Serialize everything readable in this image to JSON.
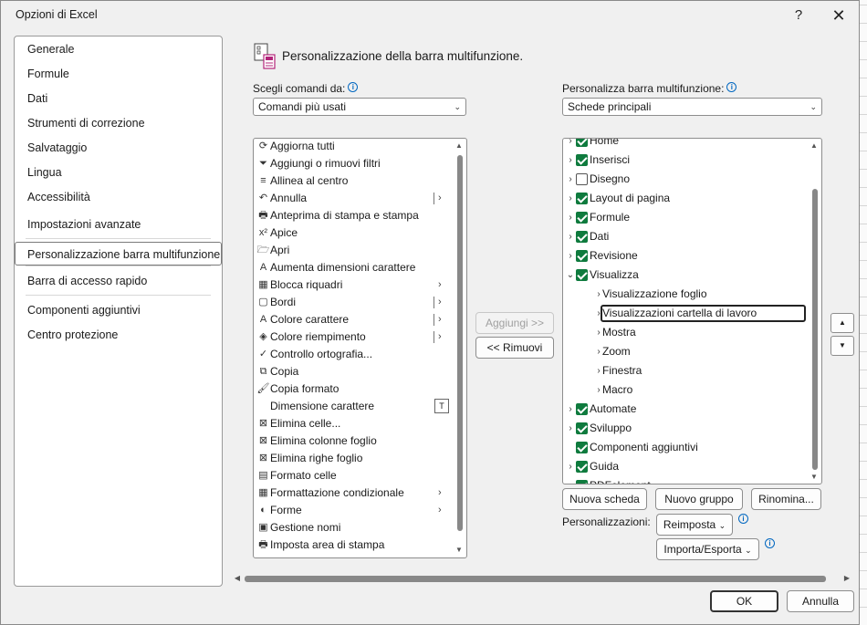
{
  "dialog": {
    "title": "Opzioni di Excel",
    "help_glyph": "?",
    "close_glyph": "✕"
  },
  "nav": {
    "items": [
      {
        "label": "Generale"
      },
      {
        "label": "Formule"
      },
      {
        "label": "Dati"
      },
      {
        "label": "Strumenti di correzione"
      },
      {
        "label": "Salvataggio"
      },
      {
        "label": "Lingua"
      },
      {
        "label": "Accessibilità"
      },
      {
        "label": "Impostazioni avanzate"
      },
      {
        "label": "Personalizzazione barra multifunzione",
        "selected": true
      },
      {
        "label": "Barra di accesso rapido"
      },
      {
        "label": "Componenti aggiuntivi"
      },
      {
        "label": "Centro protezione"
      }
    ]
  },
  "heading": {
    "text": "Personalizzazione della barra multifunzione.",
    "icon": "customize-ribbon-icon"
  },
  "left_panel": {
    "label": "Scegli comandi da:",
    "combo_value": "Comandi più usati",
    "commands": [
      {
        "label": "Aggiorna tutti",
        "icon": "refresh-icon",
        "glyph": "⟳"
      },
      {
        "label": "Aggiungi o rimuovi filtri",
        "icon": "filter-icon",
        "glyph": "⏷"
      },
      {
        "label": "Allinea al centro",
        "icon": "align-center-icon",
        "glyph": "≡"
      },
      {
        "label": "Annulla",
        "icon": "undo-icon",
        "glyph": "↶",
        "split": true
      },
      {
        "label": "Anteprima di stampa e stampa",
        "icon": "print-preview-icon",
        "glyph": "🖶"
      },
      {
        "label": "Apice",
        "icon": "superscript-icon",
        "glyph": "x²"
      },
      {
        "label": "Apri",
        "icon": "open-folder-icon",
        "glyph": "🗁"
      },
      {
        "label": "Aumenta dimensioni carattere",
        "icon": "grow-font-icon",
        "glyph": "A"
      },
      {
        "label": "Blocca riquadri",
        "icon": "freeze-panes-icon",
        "glyph": "▦",
        "submenu": true
      },
      {
        "label": "Bordi",
        "icon": "borders-icon",
        "glyph": "▢",
        "split": true
      },
      {
        "label": "Colore carattere",
        "icon": "font-color-icon",
        "glyph": "A",
        "split": true
      },
      {
        "label": "Colore riempimento",
        "icon": "fill-color-icon",
        "glyph": "◈",
        "split": true
      },
      {
        "label": "Controllo ortografia...",
        "icon": "spelling-icon",
        "glyph": "✓"
      },
      {
        "label": "Copia",
        "icon": "copy-icon",
        "glyph": "⧉"
      },
      {
        "label": "Copia formato",
        "icon": "format-painter-icon",
        "glyph": "🖌"
      },
      {
        "label": "Dimensione carattere",
        "icon": "font-size-icon",
        "glyph": "",
        "sizebox": true
      },
      {
        "label": "Elimina celle...",
        "icon": "delete-cells-icon",
        "glyph": "⊠"
      },
      {
        "label": "Elimina colonne foglio",
        "icon": "delete-columns-icon",
        "glyph": "⊠"
      },
      {
        "label": "Elimina righe foglio",
        "icon": "delete-rows-icon",
        "glyph": "⊠"
      },
      {
        "label": "Formato celle",
        "icon": "format-cells-icon",
        "glyph": "▤"
      },
      {
        "label": "Formattazione condizionale",
        "icon": "conditional-format-icon",
        "glyph": "▦",
        "submenu": true
      },
      {
        "label": "Forme",
        "icon": "shapes-icon",
        "glyph": "◐",
        "submenu": true
      },
      {
        "label": "Gestione nomi",
        "icon": "name-manager-icon",
        "glyph": "▣"
      },
      {
        "label": "Imposta area di stampa",
        "icon": "print-area-icon",
        "glyph": "🖶"
      }
    ]
  },
  "middle": {
    "add_label": "Aggiungi >>",
    "remove_label": "<< Rimuovi"
  },
  "right_panel": {
    "label": "Personalizza barra multifunzione:",
    "combo_value": "Schede principali",
    "tree": [
      {
        "label": "Home",
        "checked": true,
        "level": 0,
        "expander": "›"
      },
      {
        "label": "Inserisci",
        "checked": true,
        "level": 0,
        "expander": "›"
      },
      {
        "label": "Disegno",
        "checked": false,
        "level": 0,
        "expander": "›"
      },
      {
        "label": "Layout di pagina",
        "checked": true,
        "level": 0,
        "expander": "›"
      },
      {
        "label": "Formule",
        "checked": true,
        "level": 0,
        "expander": "›"
      },
      {
        "label": "Dati",
        "checked": true,
        "level": 0,
        "expander": "›"
      },
      {
        "label": "Revisione",
        "checked": true,
        "level": 0,
        "expander": "›"
      },
      {
        "label": "Visualizza",
        "checked": true,
        "level": 0,
        "expander": "⌄"
      },
      {
        "label": "Visualizzazione foglio",
        "level": 1,
        "expander": "›"
      },
      {
        "label": "Visualizzazioni cartella di lavoro",
        "level": 1,
        "expander": "›",
        "focused": true
      },
      {
        "label": "Mostra",
        "level": 1,
        "expander": "›"
      },
      {
        "label": "Zoom",
        "level": 1,
        "expander": "›"
      },
      {
        "label": "Finestra",
        "level": 1,
        "expander": "›"
      },
      {
        "label": "Macro",
        "level": 1,
        "expander": "›"
      },
      {
        "label": "Automate",
        "checked": true,
        "level": 0,
        "expander": "›"
      },
      {
        "label": "Sviluppo",
        "checked": true,
        "level": 0,
        "expander": "›"
      },
      {
        "label": "Componenti aggiuntivi",
        "checked": true,
        "level": 0,
        "expander": ""
      },
      {
        "label": "Guida",
        "checked": true,
        "level": 0,
        "expander": "›"
      },
      {
        "label": "PDFelement",
        "checked": true,
        "level": 0,
        "expander": "›"
      }
    ],
    "new_tab_label": "Nuova scheda",
    "new_group_label": "Nuovo gruppo",
    "rename_label": "Rinomina...",
    "customizations_label": "Personalizzazioni:",
    "reset_label": "Reimposta",
    "import_export_label": "Importa/Esporta"
  },
  "footer": {
    "ok_label": "OK",
    "cancel_label": "Annulla"
  },
  "colors": {
    "checkbox_checked": "#0f7b3e",
    "info_icon": "#0067c0"
  }
}
